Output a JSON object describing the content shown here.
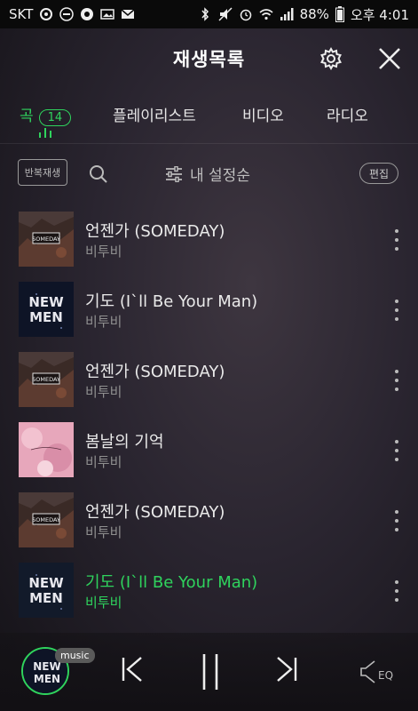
{
  "status_bar": {
    "carrier": "SKT",
    "battery": "88%",
    "time": "오후 4:01"
  },
  "header": {
    "title": "재생목록"
  },
  "tabs": [
    {
      "label": "곡",
      "count": "14"
    },
    {
      "label": "플레이리스트"
    },
    {
      "label": "비디오"
    },
    {
      "label": "라디오"
    }
  ],
  "toolbar": {
    "repeat_label": "반복재생",
    "sort_label": "내 설정순",
    "edit_label": "편집"
  },
  "songs": [
    {
      "title": "언젠가 (SOMEDAY)",
      "artist": "비투비",
      "art": "someday"
    },
    {
      "title": "기도 (I`ll Be Your Man)",
      "artist": "비투비",
      "art": "newmen"
    },
    {
      "title": "언젠가 (SOMEDAY)",
      "artist": "비투비",
      "art": "someday"
    },
    {
      "title": "봄날의 기억",
      "artist": "비투비",
      "art": "spring"
    },
    {
      "title": "언젠가 (SOMEDAY)",
      "artist": "비투비",
      "art": "someday"
    },
    {
      "title": "기도 (I`ll Be Your Man)",
      "artist": "비투비",
      "art": "newmen",
      "playing": true
    }
  ],
  "album_art_text": {
    "someday": "SOMEDAY",
    "newmen_line1": "NEW",
    "newmen_line2": "MEN"
  },
  "player": {
    "music_tag": "music",
    "eq_label": "EQ"
  },
  "colors": {
    "accent": "#2fd35d",
    "background": "#2a2530"
  }
}
